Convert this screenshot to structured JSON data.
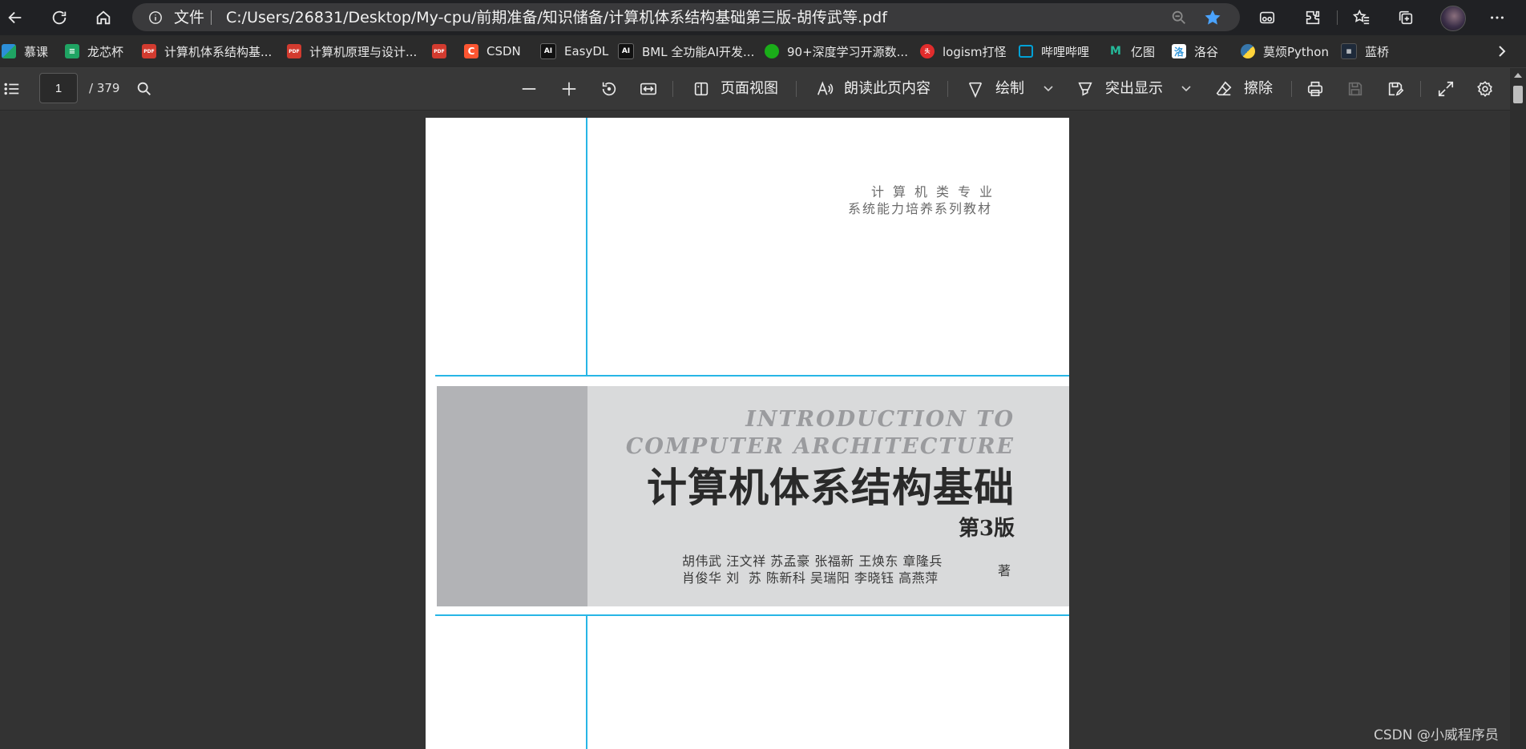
{
  "browser": {
    "address_file_label": "文件",
    "url": "C:/Users/26831/Desktop/My-cpu/前期准备/知识储备/计算机体系结构基础第三版-胡传武等.pdf"
  },
  "bookmarks": [
    {
      "label": "慕课",
      "icon": "mooc-icon",
      "color": "#2c8fd8"
    },
    {
      "label": "龙芯杯",
      "icon": "sheet-icon",
      "color": "#1fa463"
    },
    {
      "label": "计算机体系结构基...",
      "icon": "pdf-icon",
      "color": "#d23b2f"
    },
    {
      "label": "计算机原理与设计...",
      "icon": "pdf-icon",
      "color": "#d23b2f"
    },
    {
      "label": "",
      "icon": "pdf-icon",
      "color": "#d23b2f"
    },
    {
      "label": "CSDN",
      "icon": "csdn-icon",
      "color": "#fc5531"
    },
    {
      "label": "EasyDL",
      "icon": "ai-icon",
      "color": "#111111"
    },
    {
      "label": "BML 全功能AI开发...",
      "icon": "ai-icon",
      "color": "#111111"
    },
    {
      "label": "90+深度学习开源数...",
      "icon": "wechat-icon",
      "color": "#1aad19"
    },
    {
      "label": "logism打怪",
      "icon": "toutiao-icon",
      "color": "#e12c2c"
    },
    {
      "label": "哔哩哔哩",
      "icon": "bilibili-icon",
      "color": "#00a1d6"
    },
    {
      "label": "亿图",
      "icon": "edraw-icon",
      "color": "#25b99a"
    },
    {
      "label": "洛谷",
      "icon": "luogu-icon",
      "color": "#3498db"
    },
    {
      "label": "莫烦Python",
      "icon": "python-icon",
      "color": "#3776ab"
    },
    {
      "label": "蓝桥",
      "icon": "lanqiao-icon",
      "color": "#1e2a3a"
    }
  ],
  "pdf_toolbar": {
    "page_number": "1",
    "page_total": "/ 379",
    "page_view_label": "页面视图",
    "read_aloud_label": "朗读此页内容",
    "draw_label": "绘制",
    "highlight_label": "突出显示",
    "erase_label": "擦除"
  },
  "page": {
    "series_line1": "计算机类专业",
    "series_line2": "系统能力培养系列教材",
    "english_title_line1": "INTRODUCTION TO",
    "english_title_line2": "COMPUTER ARCHITECTURE",
    "chinese_title": "计算机体系结构基础",
    "edition": "第3版",
    "authors_row1": "胡伟武 汪文祥 苏孟豪 张福新 王焕东 章隆兵",
    "authors_row2": "肖俊华 刘  苏 陈新科 吴瑞阳 李晓钰 高燕萍",
    "author_suffix": "著"
  },
  "watermark": "CSDN @小威程序员"
}
